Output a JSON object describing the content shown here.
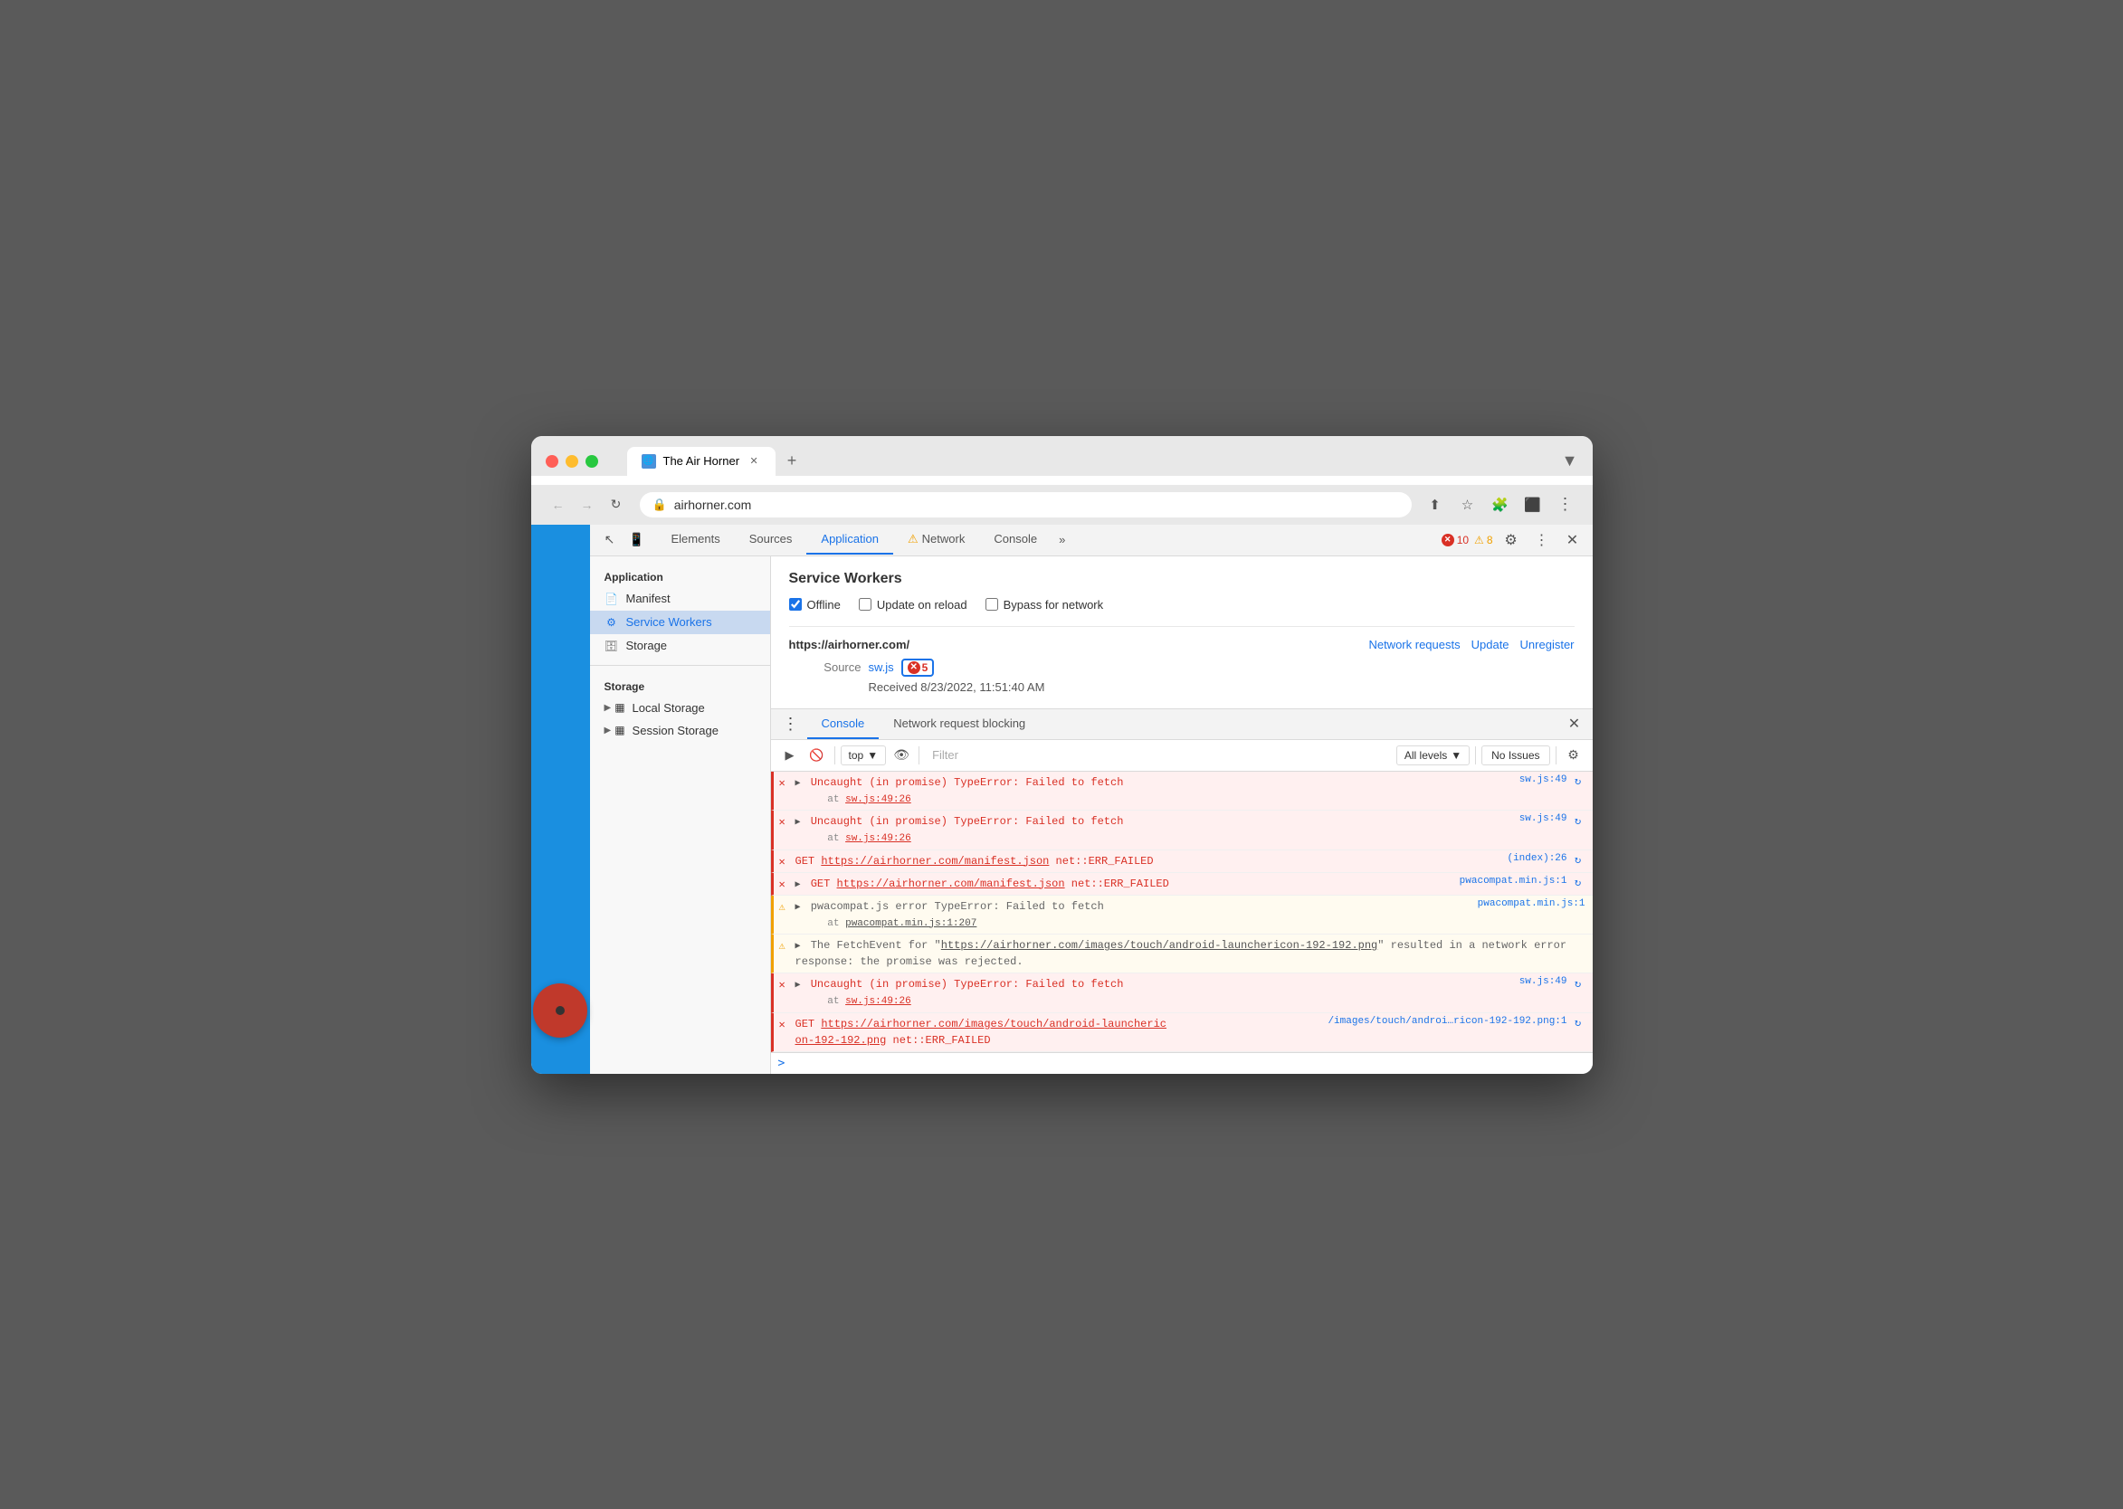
{
  "browser": {
    "tab_title": "The Air Horner",
    "url": "airhorner.com",
    "chevron_label": "▼",
    "new_tab_label": "+",
    "back_label": "←",
    "forward_label": "→",
    "refresh_label": "↻"
  },
  "devtools": {
    "tabs": [
      {
        "id": "elements",
        "label": "Elements",
        "active": false
      },
      {
        "id": "sources",
        "label": "Sources",
        "active": false
      },
      {
        "id": "application",
        "label": "Application",
        "active": true
      },
      {
        "id": "network",
        "label": "Network",
        "active": false,
        "warning": true
      },
      {
        "id": "console",
        "label": "Console",
        "active": false
      }
    ],
    "more_tabs_label": "»",
    "error_count": "10",
    "warning_count": "8",
    "settings_label": "⚙",
    "more_label": "⋮",
    "close_label": "✕"
  },
  "sidebar": {
    "app_section": "Application",
    "items": [
      {
        "id": "manifest",
        "label": "Manifest",
        "icon": "📄"
      },
      {
        "id": "service-workers",
        "label": "Service Workers",
        "active": true,
        "icon": "⚙"
      },
      {
        "id": "storage",
        "label": "Storage",
        "icon": "🗄"
      }
    ],
    "storage_section": "Storage",
    "storage_items": [
      {
        "id": "local-storage",
        "label": "Local Storage",
        "expandable": true
      },
      {
        "id": "session-storage",
        "label": "Session Storage",
        "expandable": true
      }
    ]
  },
  "service_workers": {
    "title": "Service Workers",
    "offline_label": "Offline",
    "offline_checked": true,
    "update_on_reload_label": "Update on reload",
    "update_on_reload_checked": false,
    "bypass_label": "Bypass for network",
    "bypass_checked": false,
    "origin": "https://airhorner.com/",
    "network_requests_label": "Network requests",
    "update_label": "Update",
    "unregister_label": "Unregister",
    "source_label": "Source",
    "source_file": "sw.js",
    "error_count": "5",
    "received_label": "Received 8/23/2022, 11:51:40 AM"
  },
  "console": {
    "tabs": [
      {
        "id": "console",
        "label": "Console",
        "active": true
      },
      {
        "id": "network-request-blocking",
        "label": "Network request blocking",
        "active": false
      }
    ],
    "close_label": "✕",
    "controls": {
      "play_label": "▶",
      "block_label": "🚫",
      "context_label": "top",
      "eye_label": "👁",
      "filter_placeholder": "Filter",
      "levels_label": "All levels",
      "no_issues_label": "No Issues",
      "settings_label": "⚙"
    },
    "entries": [
      {
        "type": "error",
        "expand": true,
        "message": "Uncaught (in promise) TypeError: Failed to fetch",
        "sub": "at sw.js:49:26",
        "sub_link": "sw.js:49:26",
        "source": "sw.js:49",
        "has_reload": true
      },
      {
        "type": "error",
        "expand": true,
        "message": "Uncaught (in promise) TypeError: Failed to fetch",
        "sub": "at sw.js:49:26",
        "sub_link": "sw.js:49:26",
        "source": "sw.js:49",
        "has_reload": true
      },
      {
        "type": "error",
        "expand": false,
        "message": "GET https://airhorner.com/manifest.json net::ERR_FAILED",
        "source": "(index):26",
        "has_reload": true
      },
      {
        "type": "error",
        "expand": true,
        "message": "GET https://airhorner.com/manifest.json net::ERR_FAILED",
        "source": "pwacompat.min.js:1",
        "has_reload": true
      },
      {
        "type": "warning",
        "expand": true,
        "message": "pwacompat.js error TypeError: Failed to fetch",
        "sub": "at pwacompat.min.js:1:207",
        "sub_link": "pwacompat.min.js:1:207",
        "source": "pwacompat.min.js:1",
        "has_reload": false
      },
      {
        "type": "warning",
        "expand": true,
        "message": "The FetchEvent for \"https://airhorner.com/images/touch/android-launchericon-192-192.png\" resulted in a network error response: the promise was rejected.",
        "source": "",
        "has_reload": false
      },
      {
        "type": "error",
        "expand": true,
        "message": "Uncaught (in promise) TypeError: Failed to fetch",
        "sub": "at sw.js:49:26",
        "sub_link": "sw.js:49:26",
        "source": "sw.js:49",
        "has_reload": true
      },
      {
        "type": "error",
        "expand": false,
        "message": "GET https://airhorner.com/images/touch/android-launcheric on-192-192.png net::ERR_FAILED",
        "source": "/images/touch/androi…ricon-192-192.png:1",
        "has_reload": true
      }
    ],
    "prompt_label": ">",
    "input_placeholder": ""
  }
}
